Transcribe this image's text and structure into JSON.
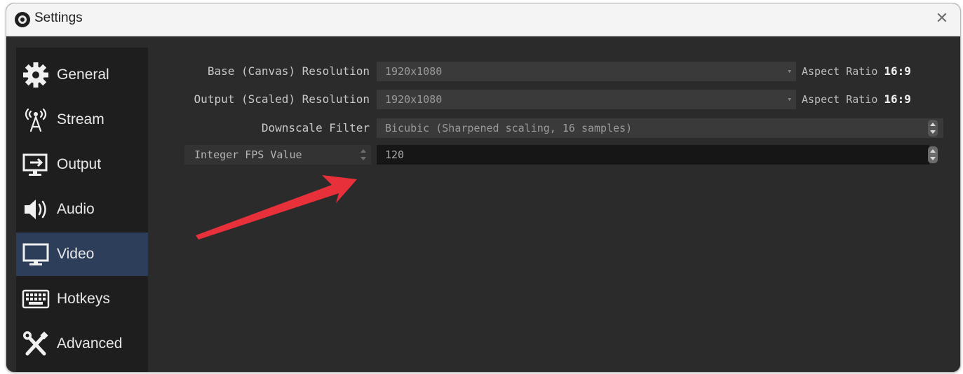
{
  "window": {
    "title": "Settings",
    "close_glyph": "✕"
  },
  "sidebar": {
    "items": [
      {
        "label": "General",
        "icon": "gear-icon"
      },
      {
        "label": "Stream",
        "icon": "antenna-icon"
      },
      {
        "label": "Output",
        "icon": "output-monitor-icon"
      },
      {
        "label": "Audio",
        "icon": "speaker-icon"
      },
      {
        "label": "Video",
        "icon": "monitor-icon",
        "active": true
      },
      {
        "label": "Hotkeys",
        "icon": "keyboard-icon"
      },
      {
        "label": "Advanced",
        "icon": "tools-icon"
      }
    ]
  },
  "video": {
    "base_resolution": {
      "label": "Base (Canvas) Resolution",
      "value": "1920x1080",
      "aspect_label": "Aspect Ratio",
      "aspect_value": "16:9"
    },
    "output_resolution": {
      "label": "Output (Scaled) Resolution",
      "value": "1920x1080",
      "aspect_label": "Aspect Ratio",
      "aspect_value": "16:9"
    },
    "downscale_filter": {
      "label": "Downscale Filter",
      "value": "Bicubic (Sharpened scaling, 16 samples)"
    },
    "fps": {
      "mode": "Integer FPS Value",
      "value": "120"
    }
  },
  "colors": {
    "annotation_arrow": "#e8303a",
    "active_nav": "#2c3e5a"
  }
}
